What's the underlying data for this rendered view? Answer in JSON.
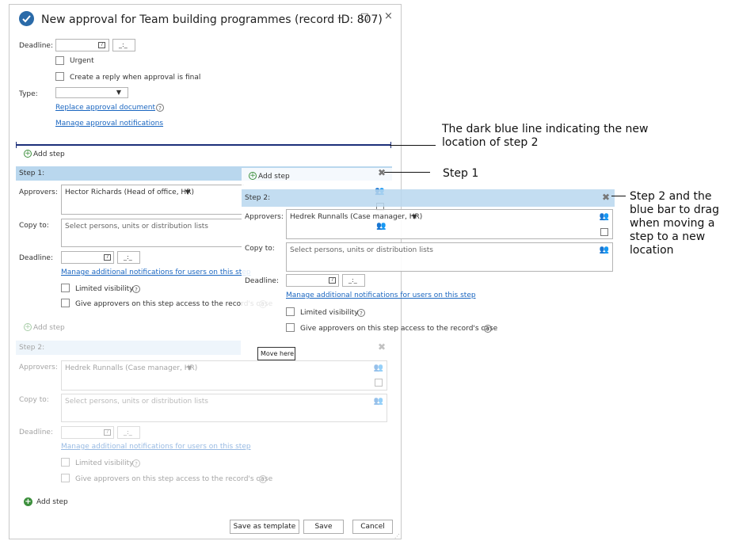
{
  "window": {
    "title": "New approval for Team building programmes (record ID: 807)",
    "minimize_glyph": "‒",
    "maximize_glyph": "□",
    "close_glyph": "×"
  },
  "form": {
    "deadline_label": "Deadline:",
    "time_placeholder": "_:_",
    "urgent_label": "Urgent",
    "create_reply_label": "Create a reply when approval is final",
    "type_label": "Type:",
    "replace_link": "Replace approval document",
    "manage_notifications_link": "Manage approval notifications"
  },
  "add_step_label": "Add step",
  "step1": {
    "header": "Step 1:",
    "approvers_label": "Approvers:",
    "approvers_value": "Hector Richards (Head of office, HR)",
    "copy_to_label": "Copy to:",
    "copy_to_placeholder": "Select persons, units or distribution lists",
    "deadline_label": "Deadline:",
    "time_placeholder": "_:_",
    "manage_link": "Manage additional notifications for users on this step",
    "limited_label": "Limited visibility",
    "give_access_label": "Give approvers on this step access to the record's case"
  },
  "step2_ghost": {
    "add_step_label": "Add step",
    "header": "Step 2:",
    "approvers_label": "Approvers:",
    "approvers_value": "Hedrek Runnalls (Case manager, HR)",
    "copy_to_label": "Copy to:",
    "copy_to_placeholder": "Select persons, units or distribution lists",
    "deadline_label": "Deadline:",
    "time_placeholder": "_:_",
    "manage_link": "Manage additional notifications for users on this step",
    "limited_label": "Limited visibility",
    "give_access_label": "Give approvers on this step access to the record's case"
  },
  "step2_faded": {
    "add_step_label": "Add step",
    "header": "Step 2:",
    "approvers_label": "Approvers:",
    "approvers_value": "Hedrek Runnalls (Case manager, HR)",
    "copy_to_label": "Copy to:",
    "copy_to_placeholder": "Select persons, units or distribution lists",
    "deadline_label": "Deadline:",
    "time_placeholder": "_:_",
    "manage_link": "Manage additional notifications for users on this step",
    "limited_label": "Limited visibility",
    "give_access_label": "Give approvers on this step access to the record's case"
  },
  "tooltip": "Move here",
  "bottom_add_step_label": "Add step",
  "buttons": {
    "save_template": "Save as template",
    "save": "Save",
    "cancel": "Cancel"
  },
  "annotations": {
    "line_text": "The dark blue line indicating the new location of step 2",
    "step1_text": "Step 1",
    "step2_text": "Step 2 and the blue bar to drag when moving a step to a new location"
  },
  "colors": {
    "step_bar": "#b9d7ee",
    "insert_line": "#1c2f7a",
    "link": "#1a66c0",
    "add_icon": "#3c8f3c"
  },
  "icons": [
    "approval-icon",
    "calendar-icon",
    "dropdown-arrow-icon",
    "help-icon",
    "add-icon",
    "close-icon",
    "people-icon",
    "expand-icon"
  ]
}
